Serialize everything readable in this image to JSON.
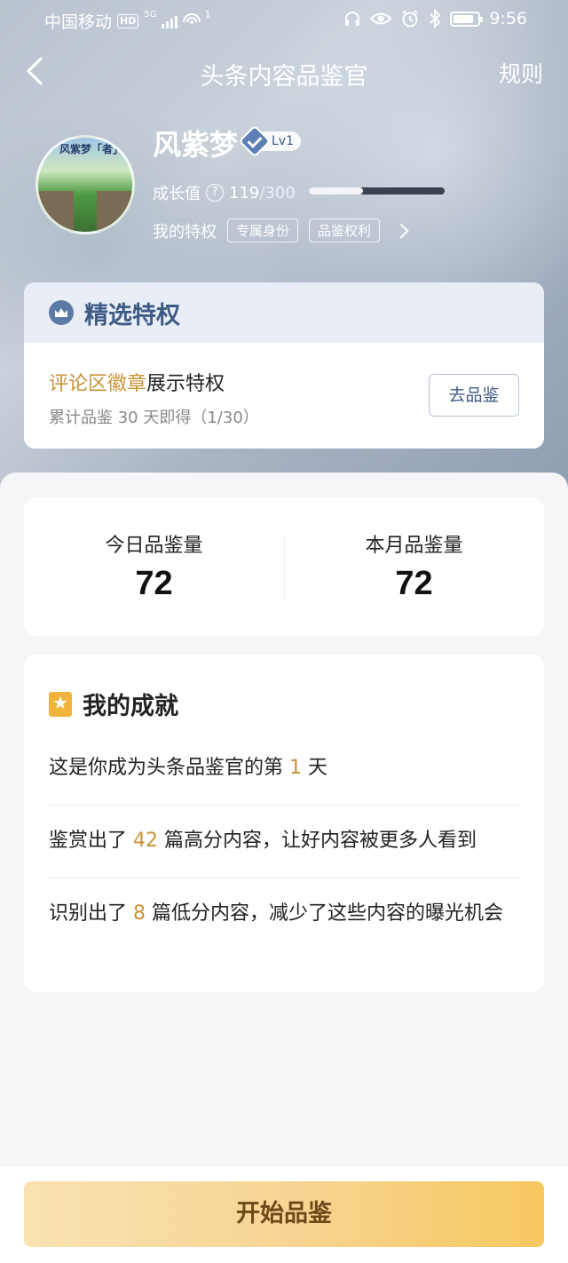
{
  "status_bar": {
    "carrier": "中国移动",
    "hd": "HD",
    "net": "5G",
    "wifi_sup": "1",
    "time": "9:56",
    "icons": [
      "headphones-icon",
      "eye-icon",
      "alarm-icon",
      "bluetooth-icon",
      "battery-icon"
    ]
  },
  "nav": {
    "title": "头条内容品鉴官",
    "rules": "规则"
  },
  "profile": {
    "name": "风紫梦",
    "level": "Lv1",
    "avatar_caption": "风紫梦「者」",
    "growth_label": "成长值",
    "growth_value": "119",
    "growth_total": "/300",
    "growth_progress_percent": 39.7,
    "privileges_label": "我的特权",
    "chips": [
      "专属身份",
      "品鉴权利"
    ]
  },
  "privilege_card": {
    "title": "精选特权",
    "highlight": "评论区徽章",
    "rest": "展示特权",
    "subtitle": "累计品鉴 30 天即得（1/30）",
    "button": "去品鉴"
  },
  "stats": {
    "today_label": "今日品鉴量",
    "today_value": "72",
    "month_label": "本月品鉴量",
    "month_value": "72"
  },
  "achievements": {
    "title": "我的成就",
    "row1_pre": "这是你成为头条品鉴官的第 ",
    "row1_num": "1",
    "row1_post": " 天",
    "row2_pre": "鉴赏出了 ",
    "row2_num": "42",
    "row2_post": " 篇高分内容，让好内容被更多人看到",
    "row3_pre": "识别出了 ",
    "row3_num": "8",
    "row3_post": " 篇低分内容，减少了这些内容的曝光机会"
  },
  "cta": {
    "label": "开始品鉴"
  },
  "colors": {
    "accent_gold": "#c99338",
    "brand_blue": "#3e5b85",
    "cta_start": "#f9e2b1",
    "cta_end": "#f6c85f"
  }
}
